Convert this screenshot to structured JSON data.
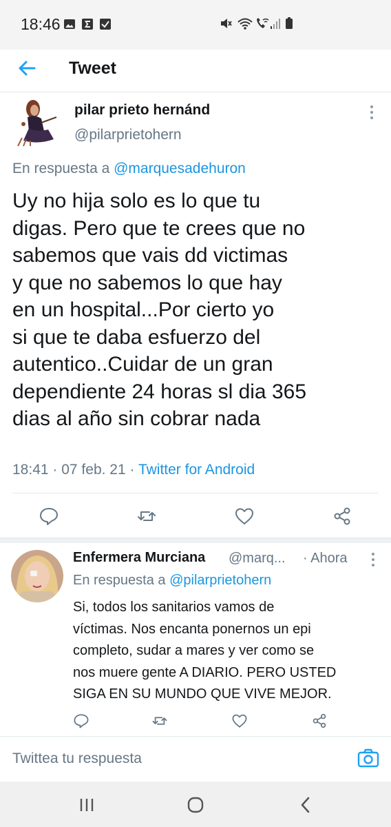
{
  "status_bar": {
    "time": "18:46",
    "left_icons": [
      "image-icon",
      "sigma-icon",
      "checkbox-icon"
    ],
    "right_icons": [
      "mute-icon",
      "wifi-icon",
      "wifi-call-icon",
      "signal-icon",
      "battery-icon"
    ]
  },
  "header": {
    "title": "Tweet",
    "back_icon": "arrow-left-icon"
  },
  "tweet": {
    "author_name": "pilar prieto hernánd",
    "author_handle": "@pilarprietohern",
    "reply_prefix": "En respuesta a ",
    "reply_to": "@marquesadehuron",
    "text": "Uy no hija solo es lo que tu\ndigas.  Pero que te crees que no\nsabemos que vais dd victimas\ny que no sabemos lo que hay\nen un hospital...Por cierto yo\nsi que te daba esfuerzo del\nautentico..Cuidar de un gran\ndependiente 24 horas sl dia 365\ndias al año sin cobrar nada",
    "time": "18:41",
    "separator": " · ",
    "date": "07 feb. 21",
    "source": "Twitter for Android",
    "actions": [
      "reply-icon",
      "retweet-icon",
      "like-icon",
      "share-icon"
    ]
  },
  "reply": {
    "author_name": "Enfermera Murciana",
    "author_handle": "@marq...",
    "time": "· Ahora",
    "reply_prefix": "En respuesta a ",
    "reply_to": "@pilarprietohern",
    "text": "Si, todos los sanitarios vamos de\nvíctimas. Nos encanta ponernos un epi\ncompleto, sudar a mares y ver como se\nnos muere gente A DIARIO. PERO USTED\nSIGA EN SU MUNDO QUE VIVE MEJOR.",
    "actions": [
      "reply-icon",
      "retweet-icon",
      "like-icon",
      "share-icon"
    ]
  },
  "composer": {
    "placeholder": "Twittea tu respuesta",
    "camera_icon": "camera-icon"
  },
  "nav": [
    "recent-apps-icon",
    "home-icon",
    "back-icon"
  ],
  "colors": {
    "accent": "#1da1f2",
    "link": "#1b95e0",
    "secondary_text": "#657786",
    "text": "#14171a"
  }
}
